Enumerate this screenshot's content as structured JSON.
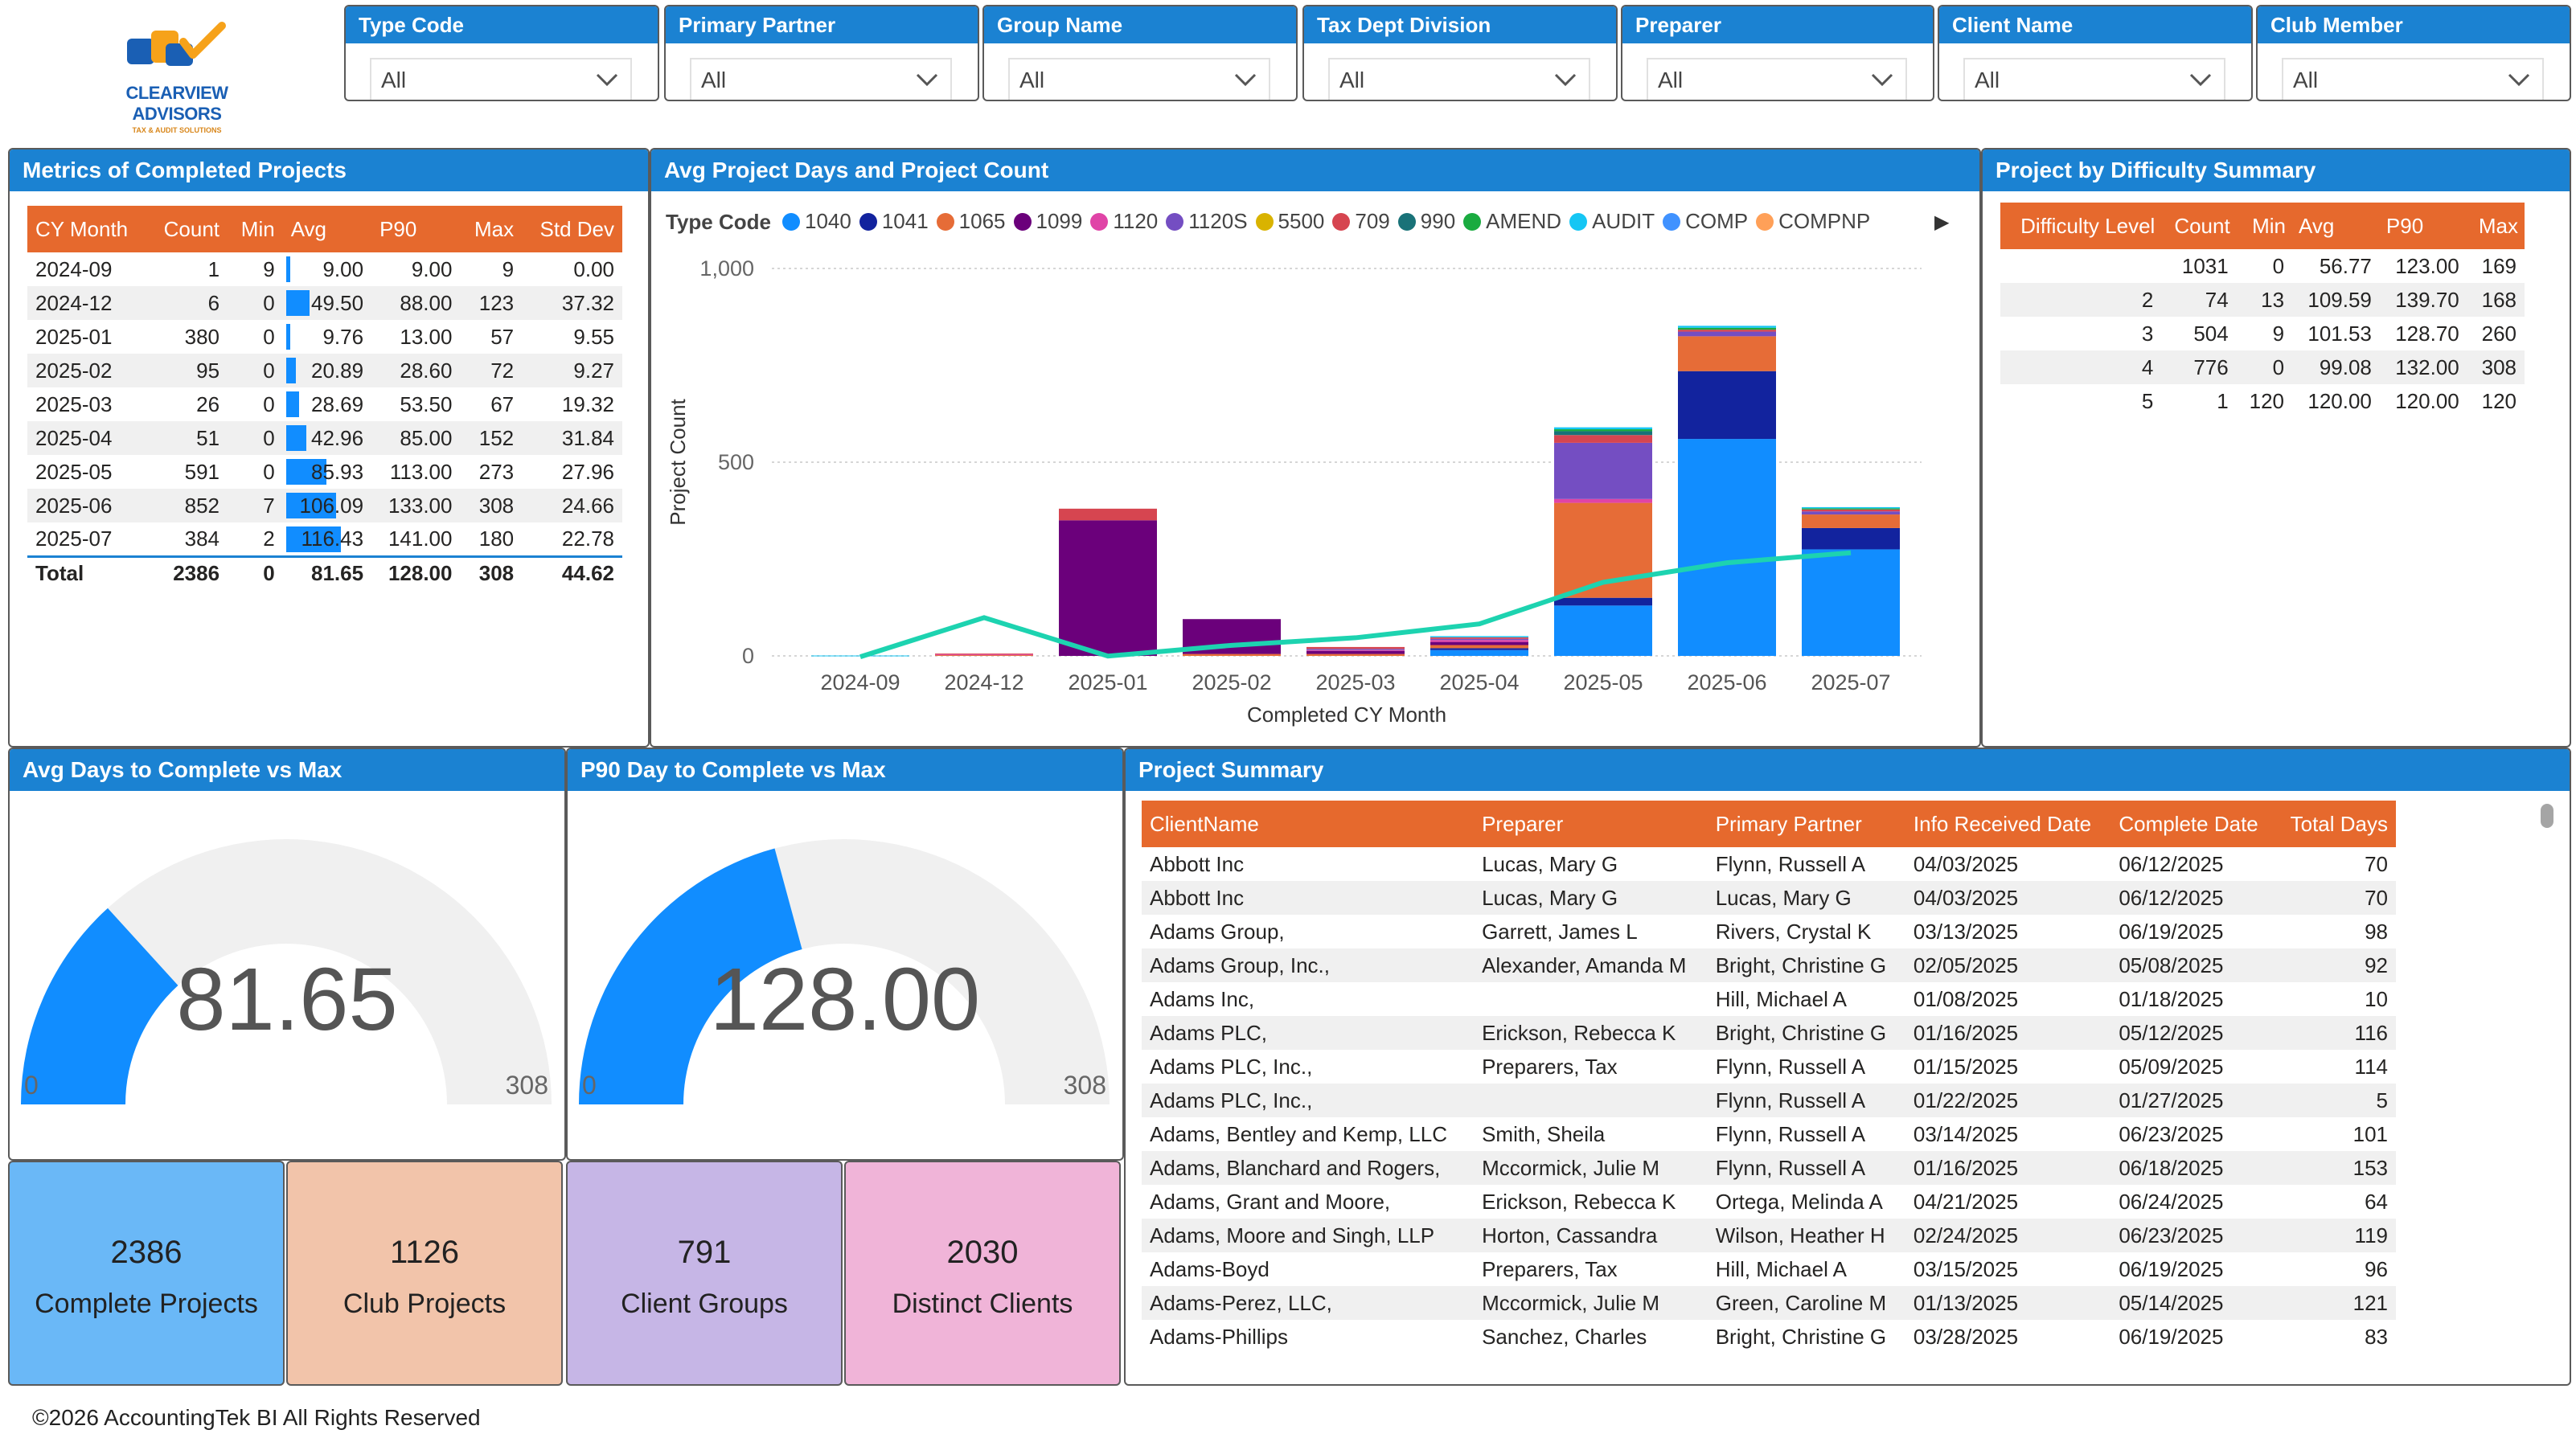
{
  "brand": {
    "logo_main": "CLEARVIEW ADVISORS",
    "logo_sub": "TAX & AUDIT SOLUTIONS"
  },
  "slicers": [
    {
      "label": "Type Code",
      "value": "All"
    },
    {
      "label": "Primary Partner",
      "value": "All"
    },
    {
      "label": "Group Name",
      "value": "All"
    },
    {
      "label": "Tax Dept Division",
      "value": "All"
    },
    {
      "label": "Preparer",
      "value": "All"
    },
    {
      "label": "Client Name",
      "value": "All"
    },
    {
      "label": "Club Member",
      "value": "All"
    }
  ],
  "metrics": {
    "title": "Metrics of Completed Projects",
    "columns": [
      "CY Month",
      "Count",
      "Min",
      "Avg",
      "P90",
      "Max",
      "Std Dev"
    ],
    "rows": [
      {
        "month": "2024-09",
        "count": "1",
        "min": "9",
        "avg": "9.00",
        "avg_value": 9.0,
        "p90": "9.00",
        "max": "9",
        "std": "0.00"
      },
      {
        "month": "2024-12",
        "count": "6",
        "min": "0",
        "avg": "49.50",
        "avg_value": 49.5,
        "p90": "88.00",
        "max": "123",
        "std": "37.32"
      },
      {
        "month": "2025-01",
        "count": "380",
        "min": "0",
        "avg": "9.76",
        "avg_value": 9.76,
        "p90": "13.00",
        "max": "57",
        "std": "9.55"
      },
      {
        "month": "2025-02",
        "count": "95",
        "min": "0",
        "avg": "20.89",
        "avg_value": 20.89,
        "p90": "28.60",
        "max": "72",
        "std": "9.27"
      },
      {
        "month": "2025-03",
        "count": "26",
        "min": "0",
        "avg": "28.69",
        "avg_value": 28.69,
        "p90": "53.50",
        "max": "67",
        "std": "19.32"
      },
      {
        "month": "2025-04",
        "count": "51",
        "min": "0",
        "avg": "42.96",
        "avg_value": 42.96,
        "p90": "85.00",
        "max": "152",
        "std": "31.84"
      },
      {
        "month": "2025-05",
        "count": "591",
        "min": "0",
        "avg": "85.93",
        "avg_value": 85.93,
        "p90": "113.00",
        "max": "273",
        "std": "27.96"
      },
      {
        "month": "2025-06",
        "count": "852",
        "min": "7",
        "avg": "106.09",
        "avg_value": 106.09,
        "p90": "133.00",
        "max": "308",
        "std": "24.66"
      },
      {
        "month": "2025-07",
        "count": "384",
        "min": "2",
        "avg": "116.43",
        "avg_value": 116.43,
        "p90": "141.00",
        "max": "180",
        "std": "22.78"
      }
    ],
    "total": {
      "label": "Total",
      "count": "2386",
      "min": "0",
      "avg": "81.65",
      "p90": "128.00",
      "max": "308",
      "std": "44.62"
    }
  },
  "chart_panel": {
    "title": "Avg Project Days and Project Count",
    "legend_title": "Type Code"
  },
  "chart_data": {
    "type": "bar",
    "stacked": true,
    "xlabel": "Completed CY Month",
    "ylabel": "Project Count",
    "ylim": [
      0,
      1000
    ],
    "yticks": [
      "0",
      "500",
      "1,000"
    ],
    "grid": true,
    "legend_placement": "top",
    "categories": [
      "2024-09",
      "2024-12",
      "2025-01",
      "2025-02",
      "2025-03",
      "2025-04",
      "2025-05",
      "2025-06",
      "2025-07"
    ],
    "series": [
      {
        "name": "1040",
        "color": "#118dff",
        "values": [
          0,
          0,
          0,
          0,
          0,
          15,
          130,
          560,
          275
        ]
      },
      {
        "name": "1041",
        "color": "#12239e",
        "values": [
          0,
          0,
          0,
          0,
          0,
          5,
          20,
          175,
          55
        ]
      },
      {
        "name": "1065",
        "color": "#e66c37",
        "values": [
          0,
          2,
          0,
          5,
          5,
          8,
          245,
          90,
          35
        ]
      },
      {
        "name": "1099",
        "color": "#6b007b",
        "values": [
          0,
          0,
          350,
          90,
          8,
          8,
          0,
          0,
          0
        ]
      },
      {
        "name": "1120",
        "color": "#e044a7",
        "values": [
          0,
          2,
          0,
          0,
          2,
          5,
          10,
          0,
          0
        ]
      },
      {
        "name": "1120S",
        "color": "#744ec2",
        "values": [
          0,
          0,
          0,
          0,
          3,
          3,
          145,
          12,
          8
        ]
      },
      {
        "name": "5500",
        "color": "#d9b300",
        "values": [
          0,
          0,
          0,
          0,
          0,
          0,
          0,
          0,
          0
        ]
      },
      {
        "name": "709",
        "color": "#d64550",
        "values": [
          0,
          2,
          30,
          0,
          5,
          4,
          20,
          5,
          5
        ]
      },
      {
        "name": "990",
        "color": "#197278",
        "values": [
          0,
          0,
          0,
          0,
          0,
          0,
          10,
          0,
          0
        ]
      },
      {
        "name": "AMEND",
        "color": "#1aab40",
        "values": [
          0,
          0,
          0,
          0,
          0,
          0,
          5,
          5,
          3
        ]
      },
      {
        "name": "AUDIT",
        "color": "#15c6f4",
        "values": [
          1,
          0,
          0,
          0,
          0,
          3,
          5,
          5,
          3
        ]
      },
      {
        "name": "COMP",
        "color": "#4092ff",
        "values": [
          0,
          0,
          0,
          0,
          0,
          0,
          0,
          0,
          0
        ]
      },
      {
        "name": "COMPNP",
        "color": "#ffa058",
        "values": [
          0,
          0,
          0,
          0,
          0,
          0,
          0,
          0,
          0
        ]
      }
    ],
    "line": {
      "color": "#1dd3b0",
      "values": [
        9.0,
        49.5,
        9.76,
        20.89,
        28.69,
        42.96,
        85.93,
        106.09,
        116.43
      ]
    }
  },
  "difficulty": {
    "title": "Project by Difficulty Summary",
    "columns": [
      "Difficulty Level",
      "Count",
      "Min",
      "Avg",
      "P90",
      "Max"
    ],
    "rows": [
      {
        "level": "",
        "count": "1031",
        "min": "0",
        "avg": "56.77",
        "p90": "123.00",
        "max": "169"
      },
      {
        "level": "2",
        "count": "74",
        "min": "13",
        "avg": "109.59",
        "p90": "139.70",
        "max": "168"
      },
      {
        "level": "3",
        "count": "504",
        "min": "9",
        "avg": "101.53",
        "p90": "128.70",
        "max": "260"
      },
      {
        "level": "4",
        "count": "776",
        "min": "0",
        "avg": "99.08",
        "p90": "132.00",
        "max": "308"
      },
      {
        "level": "5",
        "count": "1",
        "min": "120",
        "avg": "120.00",
        "p90": "120.00",
        "max": "120"
      }
    ]
  },
  "gauges": [
    {
      "title": "Avg Days to Complete vs Max",
      "value": 81.65,
      "value_label": "81.65",
      "min": "0",
      "max": "308",
      "max_value": 308
    },
    {
      "title": "P90 Day to Complete vs Max",
      "value": 128.0,
      "value_label": "128.00",
      "min": "0",
      "max": "308",
      "max_value": 308
    }
  ],
  "kpis": [
    {
      "value": "2386",
      "label": "Complete Projects",
      "color": "#6ab8f7"
    },
    {
      "value": "1126",
      "label": "Club Projects",
      "color": "#f2c4aa"
    },
    {
      "value": "791",
      "label": "Client Groups",
      "color": "#c6b6e6"
    },
    {
      "value": "2030",
      "label": "Distinct Clients",
      "color": "#f0b4d8"
    }
  ],
  "summary": {
    "title": "Project Summary",
    "columns": [
      "ClientName",
      "Preparer",
      "Primary Partner",
      "Info Received Date",
      "Complete Date",
      "Total Days"
    ],
    "rows": [
      [
        "Abbott Inc",
        "Lucas, Mary G",
        "Flynn, Russell A",
        "04/03/2025",
        "06/12/2025",
        "70"
      ],
      [
        "Abbott Inc",
        "Lucas, Mary G",
        "Lucas, Mary G",
        "04/03/2025",
        "06/12/2025",
        "70"
      ],
      [
        "Adams Group,",
        "Garrett, James L",
        "Rivers, Crystal K",
        "03/13/2025",
        "06/19/2025",
        "98"
      ],
      [
        "Adams Group, Inc.,",
        "Alexander, Amanda M",
        "Bright, Christine G",
        "02/05/2025",
        "05/08/2025",
        "92"
      ],
      [
        "Adams Inc,",
        "",
        "Hill, Michael A",
        "01/08/2025",
        "01/18/2025",
        "10"
      ],
      [
        "Adams PLC,",
        "Erickson, Rebecca K",
        "Bright, Christine G",
        "01/16/2025",
        "05/12/2025",
        "116"
      ],
      [
        "Adams PLC, Inc.,",
        "Preparers, Tax",
        "Flynn, Russell A",
        "01/15/2025",
        "05/09/2025",
        "114"
      ],
      [
        "Adams PLC, Inc.,",
        "",
        "Flynn, Russell A",
        "01/22/2025",
        "01/27/2025",
        "5"
      ],
      [
        "Adams, Bentley and Kemp, LLC",
        "Smith, Sheila",
        "Flynn, Russell A",
        "03/14/2025",
        "06/23/2025",
        "101"
      ],
      [
        "Adams, Blanchard and Rogers,",
        "Mccormick, Julie M",
        "Flynn, Russell A",
        "01/16/2025",
        "06/18/2025",
        "153"
      ],
      [
        "Adams, Grant and Moore,",
        "Erickson, Rebecca K",
        "Ortega, Melinda A",
        "04/21/2025",
        "06/24/2025",
        "64"
      ],
      [
        "Adams, Moore and Singh, LLP",
        "Horton, Cassandra",
        "Wilson, Heather H",
        "02/24/2025",
        "06/23/2025",
        "119"
      ],
      [
        "Adams-Boyd",
        "Preparers, Tax",
        "Hill, Michael A",
        "03/15/2025",
        "06/19/2025",
        "96"
      ],
      [
        "Adams-Perez, LLC,",
        "Mccormick, Julie M",
        "Green, Caroline M",
        "01/13/2025",
        "05/14/2025",
        "121"
      ],
      [
        "Adams-Phillips",
        "Sanchez, Charles",
        "Bright, Christine G",
        "03/28/2025",
        "06/19/2025",
        "83"
      ]
    ]
  },
  "footer": "©2026 AccountingTek BI All Rights Reserved"
}
